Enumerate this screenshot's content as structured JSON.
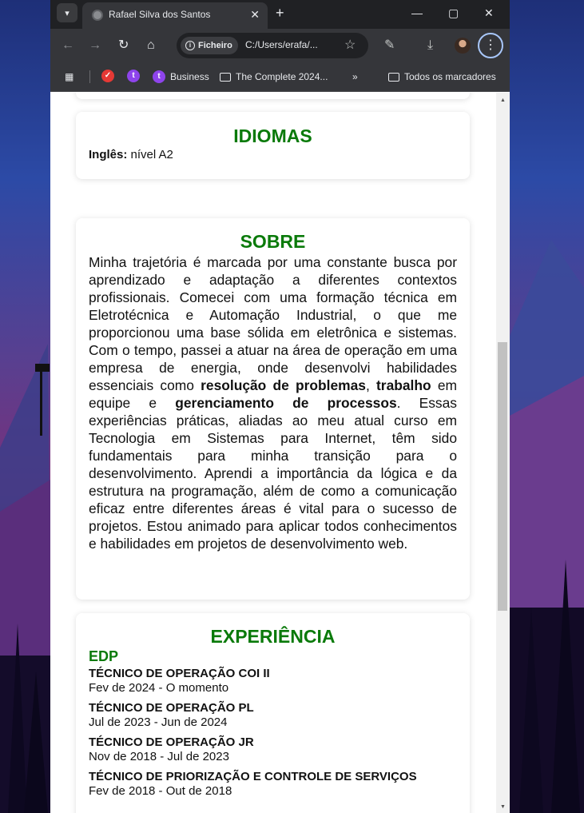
{
  "browser": {
    "tab_title": "Rafael Silva dos Santos",
    "tab_close": "✕",
    "new_tab": "+",
    "chip_label": "Ficheiro",
    "url": "C:/Users/erafa/...",
    "bookmarks": [
      {
        "label": "Business",
        "icon": "twitch-icon"
      },
      {
        "label": "The Complete 2024...",
        "icon": "folder-icon"
      }
    ],
    "all_bookmarks": "Todos os marcadores",
    "overflow": "»"
  },
  "languages": {
    "heading": "IDIOMAS",
    "items": [
      {
        "label": "Inglês:",
        "value": " nível A2"
      }
    ]
  },
  "about": {
    "heading": "SOBRE",
    "text_1": "Minha trajetória é marcada por uma constante busca por aprendizado e adaptação a diferentes contextos profissionais. Comecei com uma formação técnica em Eletrotécnica e Automação Industrial, o que me proporcionou uma base sólida em eletrônica e sistemas. Com o tempo, passei a atuar na área de operação em uma empresa de energia, onde desenvolvi habilidades essenciais como ",
    "bold_1": "resolução de problemas",
    "text_2": ", ",
    "bold_2": "trabalho",
    "text_3": " em equipe e ",
    "bold_3": "gerenciamento de processos",
    "text_4": ". Essas experiências práticas, aliadas ao meu atual curso em Tecnologia em Sistemas para Internet, têm sido fundamentais para minha transição para o desenvolvimento. Aprendi a importância da lógica e da estrutura na programação, além de como a comunicação eficaz entre diferentes áreas é vital para o sucesso de projetos. Estou animado para aplicar todos conhecimentos e habilidades em projetos de desenvolvimento web."
  },
  "experience": {
    "heading": "EXPERIÊNCIA",
    "company": "EDP",
    "jobs": [
      {
        "title": "TÉCNICO DE OPERAÇÃO COI II",
        "period": "Fev de 2024 - O momento"
      },
      {
        "title": "TÉCNICO DE OPERAÇÃO PL",
        "period": "Jul de 2023 - Jun de 2024"
      },
      {
        "title": "TÉCNICO DE OPERAÇÃO JR",
        "period": "Nov de 2018 - Jul de 2023"
      },
      {
        "title": "TÉCNICO DE PRIORIZAÇÃO E CONTROLE DE SERVIÇOS",
        "period": "Fev de 2018 - Out de 2018"
      }
    ]
  },
  "colors": {
    "accent_green": "#0a7a0a",
    "browser_frame": "#35363a",
    "titlebar": "#202124"
  }
}
